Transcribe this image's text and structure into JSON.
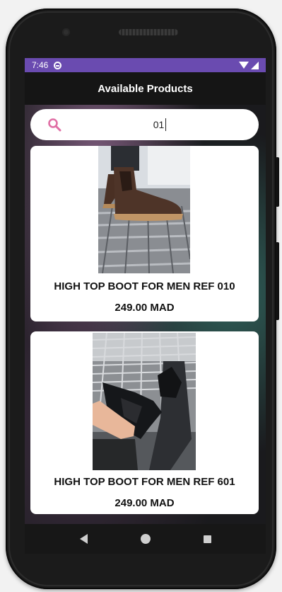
{
  "status_bar": {
    "time": "7:46"
  },
  "app_bar": {
    "title": "Available Products"
  },
  "search": {
    "value": "01",
    "icon": "search-icon"
  },
  "products": [
    {
      "name": "HIGH TOP BOOT FOR MEN REF 010",
      "price": "249.00 MAD"
    },
    {
      "name": "HIGH TOP BOOT FOR MEN REF 601",
      "price": "249.00 MAD"
    }
  ],
  "fab": {
    "icon": "add-to-cart-icon"
  },
  "colors": {
    "status_bar": "#6a4bb0",
    "accent_fab": "#3ee0c4",
    "search_icon": "#e06fa5"
  }
}
